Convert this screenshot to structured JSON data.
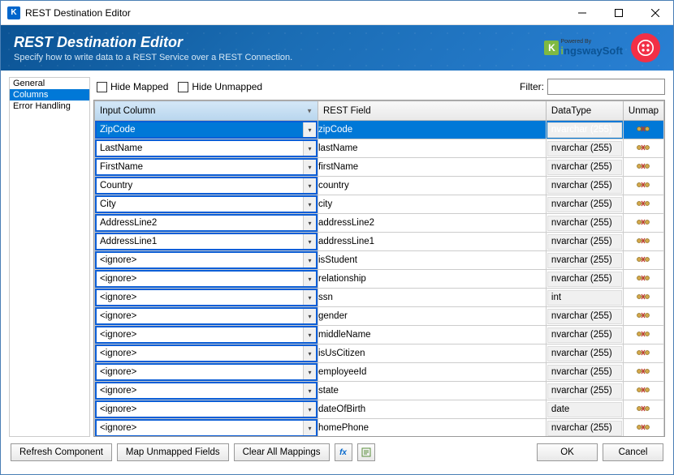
{
  "window": {
    "title": "REST Destination Editor"
  },
  "banner": {
    "title": "REST Destination Editor",
    "subtitle": "Specify how to write data to a REST Service over a REST Connection.",
    "powered_label": "Powered By",
    "brand_a": "K",
    "brand_b": "i",
    "brand_c": "ngswaySoft"
  },
  "sidebar": {
    "items": [
      "General",
      "Columns",
      "Error Handling"
    ],
    "selected": 1
  },
  "toolbar": {
    "hide_mapped": "Hide Mapped",
    "hide_unmapped": "Hide Unmapped",
    "filter_label": "Filter:"
  },
  "grid": {
    "headers": {
      "input": "Input Column",
      "rest": "REST Field",
      "type": "DataType",
      "unmap": "Unmap"
    },
    "rows": [
      {
        "input": "ZipCode",
        "rest": "zipCode",
        "type": "nvarchar (255)",
        "sel": true
      },
      {
        "input": "LastName",
        "rest": "lastName",
        "type": "nvarchar (255)"
      },
      {
        "input": "FirstName",
        "rest": "firstName",
        "type": "nvarchar (255)"
      },
      {
        "input": "Country",
        "rest": "country",
        "type": "nvarchar (255)"
      },
      {
        "input": "City",
        "rest": "city",
        "type": "nvarchar (255)"
      },
      {
        "input": "AddressLine2",
        "rest": "addressLine2",
        "type": "nvarchar (255)"
      },
      {
        "input": "AddressLine1",
        "rest": "addressLine1",
        "type": "nvarchar (255)"
      },
      {
        "input": "<ignore>",
        "rest": "isStudent",
        "type": "nvarchar (255)"
      },
      {
        "input": "<ignore>",
        "rest": "relationship",
        "type": "nvarchar (255)"
      },
      {
        "input": "<ignore>",
        "rest": "ssn",
        "type": "int"
      },
      {
        "input": "<ignore>",
        "rest": "gender",
        "type": "nvarchar (255)"
      },
      {
        "input": "<ignore>",
        "rest": "middleName",
        "type": "nvarchar (255)"
      },
      {
        "input": "<ignore>",
        "rest": "isUsCitizen",
        "type": "nvarchar (255)"
      },
      {
        "input": "<ignore>",
        "rest": "employeeId",
        "type": "nvarchar (255)"
      },
      {
        "input": "<ignore>",
        "rest": "state",
        "type": "nvarchar (255)"
      },
      {
        "input": "<ignore>",
        "rest": "dateOfBirth",
        "type": "date"
      },
      {
        "input": "<ignore>",
        "rest": "homePhone",
        "type": "nvarchar (255)"
      }
    ]
  },
  "footer": {
    "refresh": "Refresh Component",
    "map_unmapped": "Map Unmapped Fields",
    "clear_all": "Clear All Mappings",
    "ok": "OK",
    "cancel": "Cancel"
  }
}
